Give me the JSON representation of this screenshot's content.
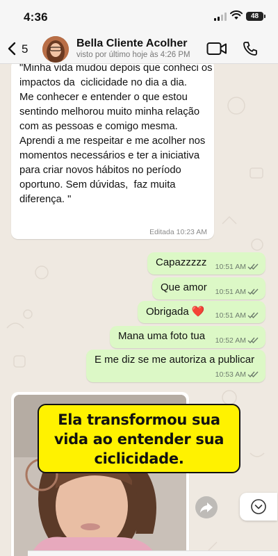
{
  "status_bar": {
    "time": "4:36",
    "battery": "48"
  },
  "header": {
    "back_count": "5",
    "contact_name": "Bella Cliente Acolher",
    "last_seen": "visto por último hoje às 4:26 PM"
  },
  "messages": {
    "long_incoming": {
      "text": "\"Minha vida mudou depois que conheci os impactos da  ciclicidade no dia a dia.\nMe conhecer e entender o que estou sentindo melhorou muito minha relação com as pessoas e comigo mesma.\nAprendi a me respeitar e me acolher nos momentos necessários e ter a iniciativa para criar novos hábitos no período oportuno. Sem dúvidas,  faz muita diferença. \"",
      "edited": "Editada  10:23 AM"
    },
    "outgoing": [
      {
        "text": "Capazzzzz",
        "time": "10:51 AM"
      },
      {
        "text": "Que amor",
        "time": "10:51 AM"
      },
      {
        "text": "Obrigada",
        "emoji": "❤️",
        "time": "10:51 AM"
      },
      {
        "text": "Mana uma foto tua",
        "time": "10:52 AM"
      },
      {
        "text": "E me diz se me autoriza a publicar",
        "time": "10:53 AM"
      }
    ]
  },
  "caption": "Ela transformou sua vida ao entender sua ciclicidade.",
  "colors": {
    "chat_background": "#efe9e1",
    "outgoing_bubble": "#dcf8c6",
    "incoming_bubble": "#ffffff",
    "caption_background": "#fff200",
    "read_ticks": "#53bdeb"
  },
  "icons": [
    "back-chevron-icon",
    "video-call-icon",
    "phone-icon",
    "forward-icon",
    "chevron-down-icon",
    "read-receipt-icon",
    "signal-icon",
    "wifi-icon",
    "battery-icon"
  ]
}
